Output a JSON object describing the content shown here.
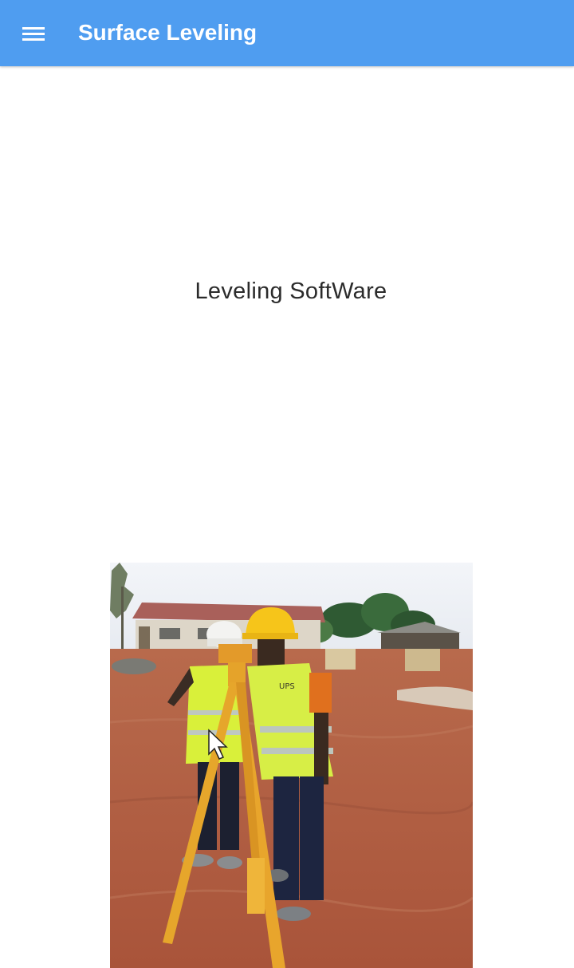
{
  "app_bar": {
    "title": "Surface Leveling",
    "menu_icon": "hamburger-menu-icon",
    "color": "#4f9df0"
  },
  "main": {
    "heading": "Leveling SoftWare",
    "image": {
      "description_icon": "survey-photo",
      "vest_label": "UPS"
    }
  }
}
